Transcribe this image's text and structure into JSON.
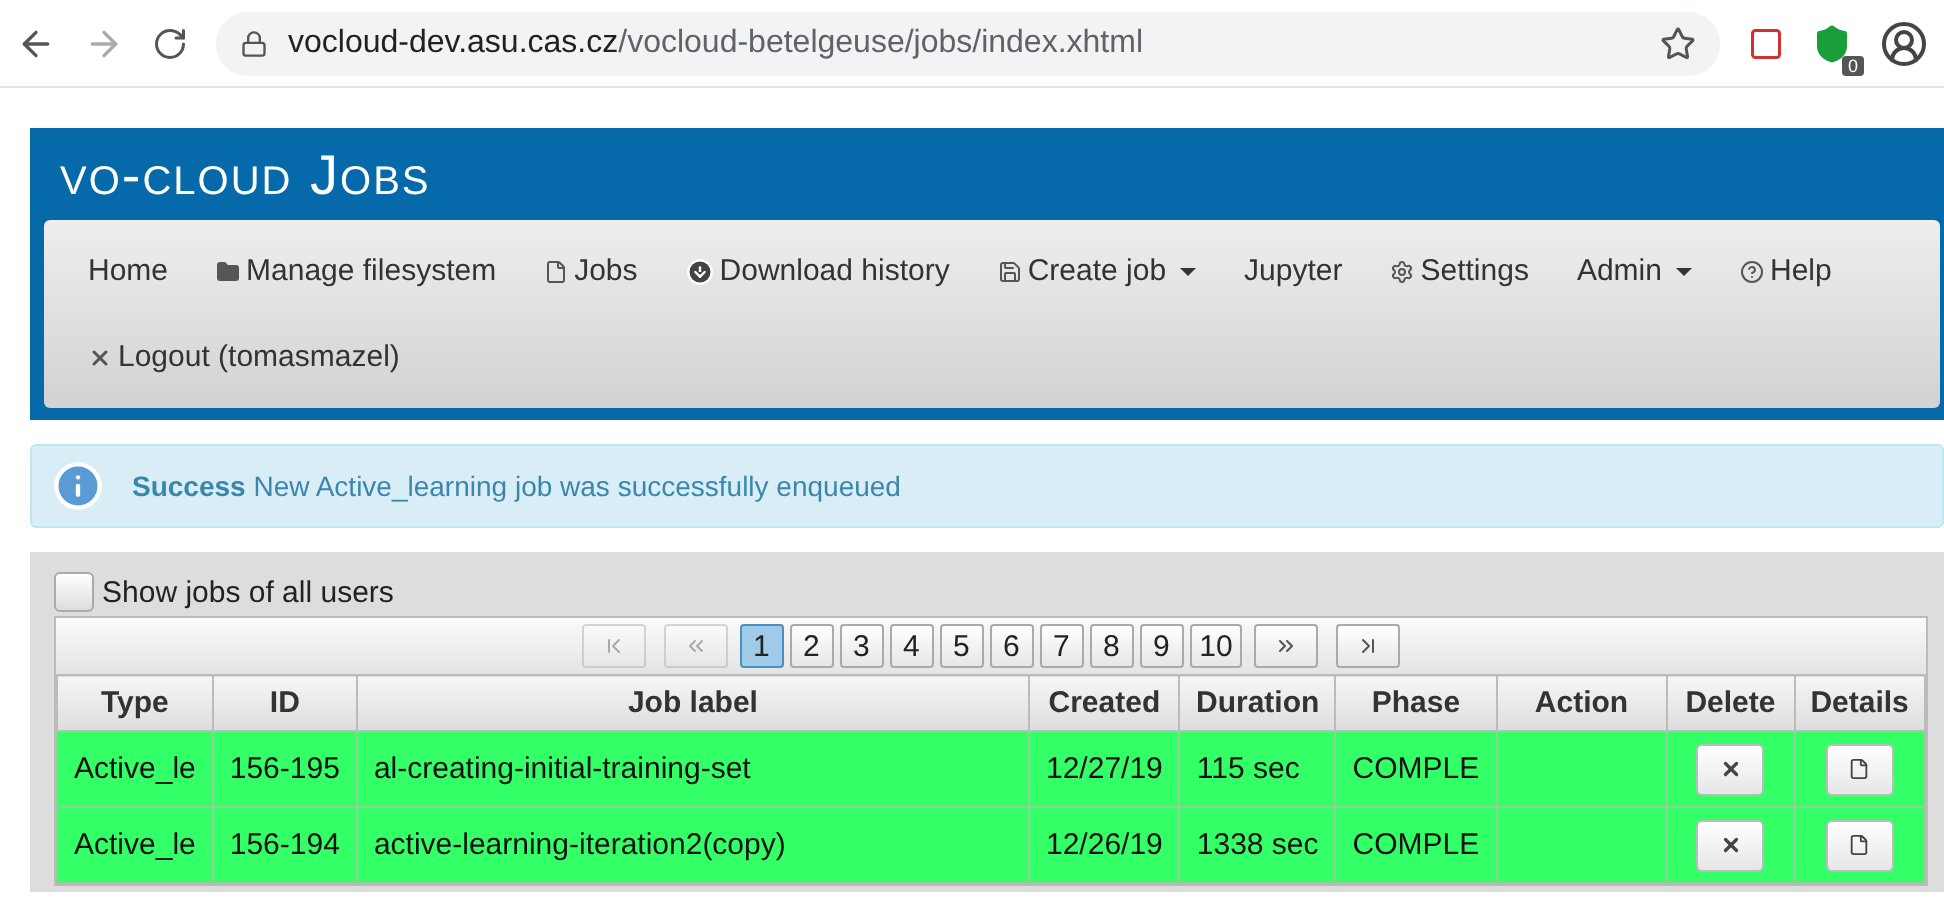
{
  "browser": {
    "url_host": "vocloud-dev.asu.cas.cz",
    "url_path": "/vocloud-betelgeuse/jobs/index.xhtml",
    "extension_badge": "0"
  },
  "header": {
    "title": "vo-cloud Jobs"
  },
  "nav": [
    {
      "label": "Home",
      "dropdown": false
    },
    {
      "label": "Manage filesystem",
      "dropdown": false
    },
    {
      "label": "Jobs",
      "dropdown": false
    },
    {
      "label": "Download history",
      "dropdown": false
    },
    {
      "label": "Create job",
      "dropdown": true
    },
    {
      "label": "Jupyter",
      "dropdown": false
    },
    {
      "label": "Settings",
      "dropdown": false
    },
    {
      "label": "Admin",
      "dropdown": true
    },
    {
      "label": "Help",
      "dropdown": false
    },
    {
      "label": "Logout (tomasmazel)",
      "dropdown": false
    }
  ],
  "alert": {
    "title": "Success",
    "message": "New Active_learning job was successfully enqueued"
  },
  "show_all": {
    "label": "Show jobs of all users",
    "checked": false
  },
  "pager": {
    "first": {
      "disabled": true
    },
    "prev": {
      "disabled": true
    },
    "next": {
      "disabled": false
    },
    "last": {
      "disabled": false
    },
    "pages": [
      {
        "label": "1",
        "selected": true
      },
      {
        "label": "2",
        "selected": false
      },
      {
        "label": "3",
        "selected": false
      },
      {
        "label": "4",
        "selected": false
      },
      {
        "label": "5",
        "selected": false
      },
      {
        "label": "6",
        "selected": false
      },
      {
        "label": "7",
        "selected": false
      },
      {
        "label": "8",
        "selected": false
      },
      {
        "label": "9",
        "selected": false
      },
      {
        "label": "10",
        "selected": false
      }
    ]
  },
  "table": {
    "columns": [
      "Type",
      "ID",
      "Job label",
      "Created",
      "Duration",
      "Phase",
      "Action",
      "Delete",
      "Details"
    ],
    "rows": [
      {
        "type": "Active_le",
        "id": "156-195",
        "label": "al-creating-initial-training-set",
        "created": "12/27/19",
        "duration": "115 sec",
        "phase": "COMPLE"
      },
      {
        "type": "Active_le",
        "id": "156-194",
        "label": "active-learning-iteration2(copy)",
        "created": "12/26/19",
        "duration": "1338 sec",
        "phase": "COMPLE"
      }
    ]
  }
}
